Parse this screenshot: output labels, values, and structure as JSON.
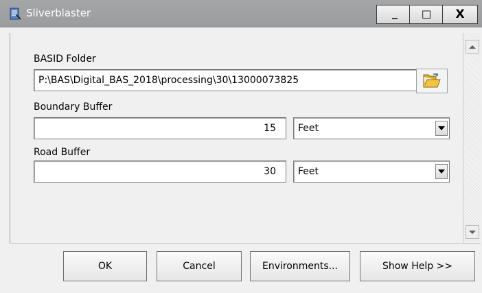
{
  "window": {
    "title": "Sliverblaster",
    "minimize_glyph": "_",
    "maximize_glyph": "☐",
    "close_glyph": "X"
  },
  "form": {
    "basid_folder": {
      "label": "BASID Folder",
      "value": "P:\\BAS\\Digital_BAS_2018\\processing\\30\\13000073825",
      "icon": "open-folder-icon"
    },
    "boundary_buffer": {
      "label": "Boundary Buffer",
      "value": "15",
      "unit": "Feet"
    },
    "road_buffer": {
      "label": "Road Buffer",
      "value": "30",
      "unit": "Feet"
    }
  },
  "buttons": {
    "ok": "OK",
    "cancel": "Cancel",
    "environments": "Environments...",
    "show_help": "Show Help >>"
  },
  "colors": {
    "titlebar": "#9c9ea0",
    "dialog_bg": "#f0f0f0"
  }
}
